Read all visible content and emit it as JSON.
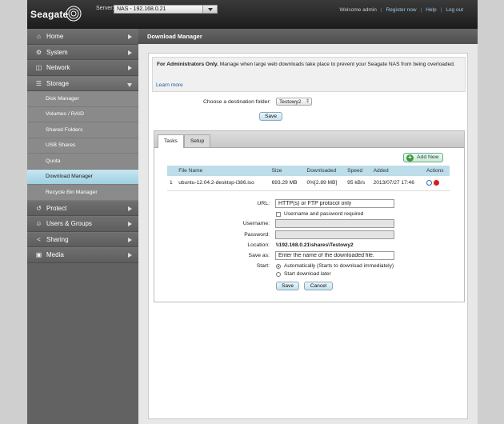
{
  "brand": {
    "name": "Seagate"
  },
  "topbar": {
    "server_label": "Server:",
    "server_value": "NAS - 192.168.0.21",
    "welcome": "Welcome admin",
    "register": "Register now",
    "help": "Help",
    "logout": "Log out",
    "sep": "|"
  },
  "sidebar": {
    "home": "Home",
    "system": "System",
    "network": "Network",
    "storage": "Storage",
    "storage_items": [
      "Disk Manager",
      "Volumes / RAID",
      "Shared Folders",
      "USB Shares",
      "Quota",
      "Download Manager",
      "Recycle Bin Manager"
    ],
    "protect": "Protect",
    "users_groups": "Users & Groups",
    "sharing": "Sharing",
    "media": "Media"
  },
  "page": {
    "title": "Download Manager",
    "notice_bold": "For Administrators Only.",
    "notice_text": " Manage when large web downloads take place to prevent your Seagate NAS from being overloaded.",
    "learn_more": "Learn more",
    "dest_label": "Choose a destination folder:",
    "dest_value": "Testowy2",
    "save": "Save"
  },
  "tabs": [
    "Tasks",
    "Setup"
  ],
  "tasks": {
    "add_new": "Add New",
    "columns": [
      "File Name",
      "Size",
      "Downloaded",
      "Speed",
      "Added",
      "Actions"
    ],
    "rows": [
      {
        "index": "1",
        "file": "ubuntu-12.04.2-desktop-i386.iso",
        "size": "693.29 MB",
        "downloaded": "0%[2.89 MB]",
        "speed": "95 kB/s",
        "added": "2013/07/27 17:46"
      }
    ]
  },
  "form": {
    "url_label": "URL:",
    "url_value": "HTTP(s) or FTP protocol only",
    "auth_check": "Username and password required",
    "username_label": "Username:",
    "password_label": "Password:",
    "location_label": "Location:",
    "location_value": "\\\\192.168.0.21\\shares\\Testowy2",
    "saveas_label": "Save as:",
    "saveas_value": "Enter the name of the downloaded file.",
    "start_label": "Start:",
    "start_auto": "Automatically (Starts to download immediately)",
    "start_later": "Start download later",
    "save": "Save",
    "cancel": "Cancel"
  },
  "colors": {
    "accent": "#9fd0e2",
    "sidebar": "#626262",
    "delete": "#d42020",
    "add": "#3a9b3a"
  },
  "icons": [
    "home-icon",
    "system-icon",
    "network-icon",
    "storage-icon",
    "protect-icon",
    "users-icon",
    "sharing-icon",
    "media-icon",
    "pause-icon",
    "delete-icon",
    "plus-icon"
  ]
}
